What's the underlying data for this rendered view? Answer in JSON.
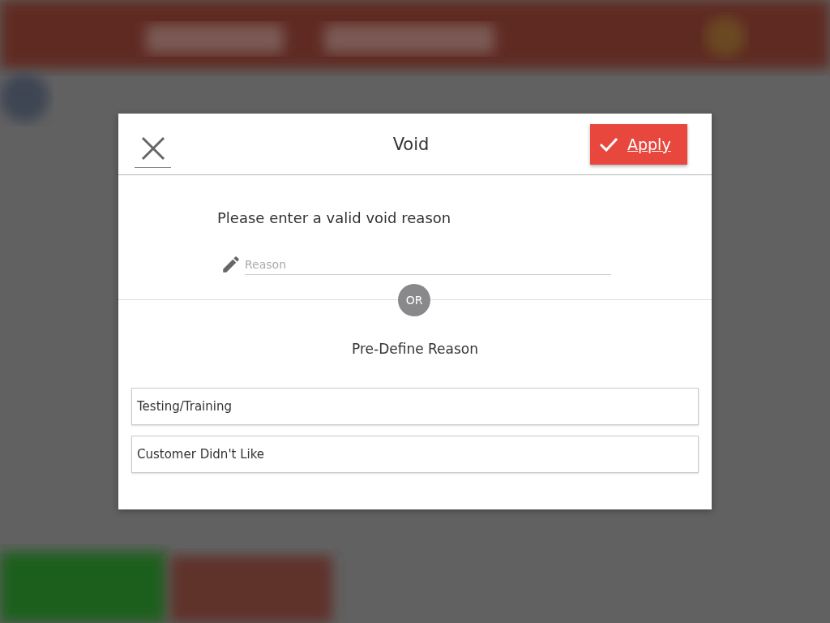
{
  "dialog": {
    "title": "Void",
    "apply_button": "Apply",
    "prompt": "Please enter a valid void reason",
    "reason_field": {
      "placeholder": "Reason"
    },
    "separator": "OR",
    "predefined_heading": "Pre-Define Reason",
    "reasons": [
      {
        "label": "Testing/Training"
      },
      {
        "label": "Customer Didn't Like"
      }
    ]
  }
}
